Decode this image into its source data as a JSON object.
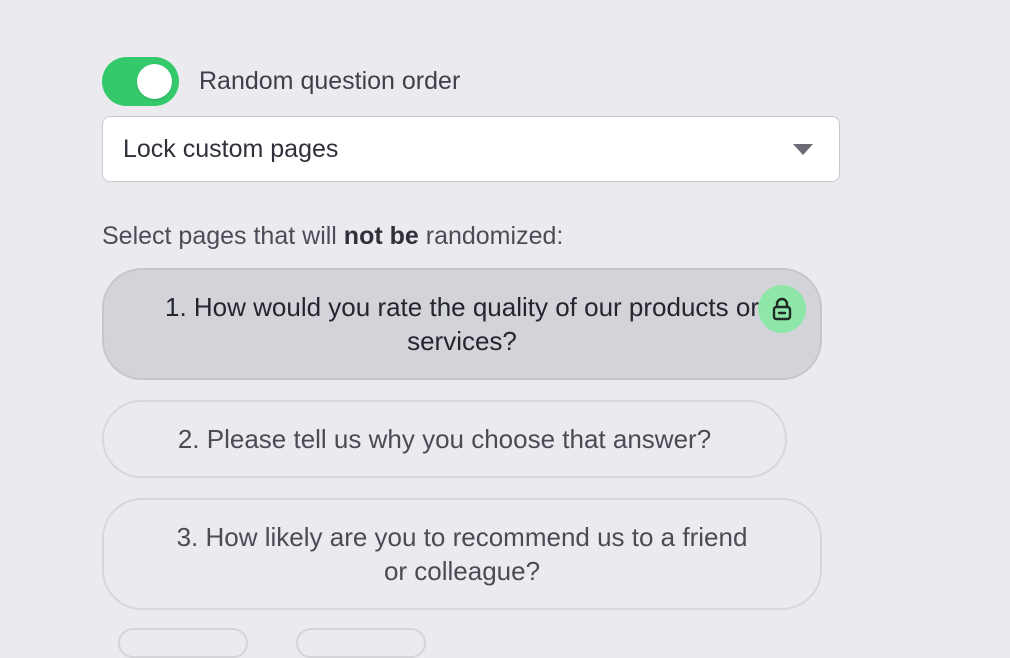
{
  "colors": {
    "accent_green": "#34c96b",
    "lock_badge_green": "#8fe6a9",
    "locked_pill_bg": "#d3d4da"
  },
  "random_order": {
    "enabled": true,
    "label": "Random question order"
  },
  "lock_select": {
    "value": "Lock custom pages",
    "icon": "chevron-down-icon"
  },
  "instruction": {
    "prefix": "Select pages that will ",
    "emphasis": "not be",
    "suffix": " randomized:"
  },
  "pages": [
    {
      "label": "1. How would you rate the quality of our products or services?",
      "locked": true,
      "icon": "lock-icon"
    },
    {
      "label": "2. Please tell us why you choose that answer?",
      "locked": false
    },
    {
      "label": "3. How likely are you to recommend us to a friend or colleague?",
      "locked": false
    }
  ]
}
